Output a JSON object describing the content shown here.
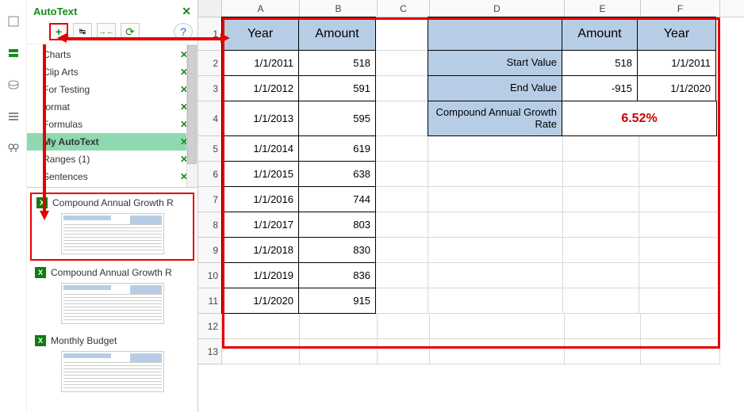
{
  "sidebar": {
    "title": "AutoText",
    "toolbar": {
      "plus": "+",
      "collapse": "↹",
      "move": "⇄",
      "refresh": "⟳",
      "help": "?"
    },
    "categories": [
      {
        "label": "Charts"
      },
      {
        "label": "Clip Arts"
      },
      {
        "label": "For Testing"
      },
      {
        "label": "format"
      },
      {
        "label": "Formulas"
      },
      {
        "label": "My AutoText",
        "selected": true
      },
      {
        "label": "Ranges (1)"
      },
      {
        "label": "Sentences"
      }
    ],
    "entries": [
      {
        "label": "Compound Annual Growth R",
        "highlight": true
      },
      {
        "label": "Compound Annual Growth R"
      },
      {
        "label": "Monthly Budget"
      }
    ]
  },
  "sheet": {
    "columns": [
      "A",
      "B",
      "C",
      "D",
      "E",
      "F"
    ],
    "headers_left": {
      "A": "Year",
      "B": "Amount"
    },
    "headers_right": {
      "E": "Amount",
      "F": "Year"
    },
    "rows_left": [
      {
        "r": 2,
        "year": "1/1/2011",
        "amount": "518"
      },
      {
        "r": 3,
        "year": "1/1/2012",
        "amount": "591"
      },
      {
        "r": 4,
        "year": "1/1/2013",
        "amount": "595"
      },
      {
        "r": 5,
        "year": "1/1/2014",
        "amount": "619"
      },
      {
        "r": 6,
        "year": "1/1/2015",
        "amount": "638"
      },
      {
        "r": 7,
        "year": "1/1/2016",
        "amount": "744"
      },
      {
        "r": 8,
        "year": "1/1/2017",
        "amount": "803"
      },
      {
        "r": 9,
        "year": "1/1/2018",
        "amount": "830"
      },
      {
        "r": 10,
        "year": "1/1/2019",
        "amount": "836"
      },
      {
        "r": 11,
        "year": "1/1/2020",
        "amount": "915"
      }
    ],
    "right_block": {
      "start": {
        "label": "Start Value",
        "amount": "518",
        "year": "1/1/2011"
      },
      "end": {
        "label": "End Value",
        "amount": "-915",
        "year": "1/1/2020"
      },
      "cagr": {
        "label": "Compound Annual Growth Rate",
        "value": "6.52%"
      }
    },
    "extra_rows": [
      12,
      13
    ]
  }
}
